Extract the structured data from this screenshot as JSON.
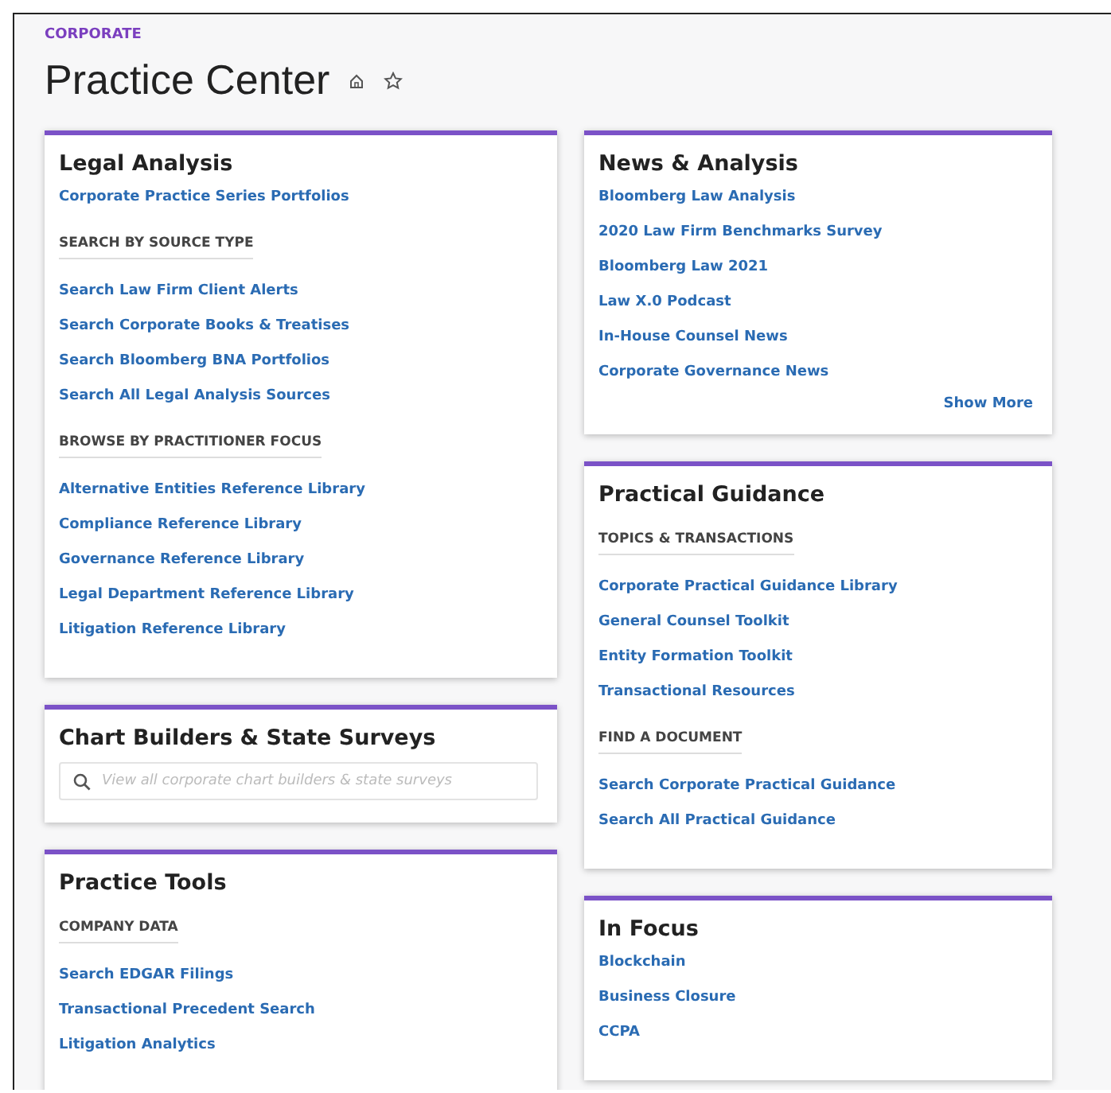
{
  "breadcrumb": "CORPORATE",
  "title": "Practice Center",
  "columns": [
    [
      {
        "title": "Legal Analysis",
        "items": [
          {
            "kind": "link",
            "text": "Corporate Practice Series Portfolios"
          },
          {
            "kind": "heading",
            "text": "SEARCH BY SOURCE TYPE"
          },
          {
            "kind": "link",
            "text": "Search Law Firm Client Alerts"
          },
          {
            "kind": "link",
            "text": "Search Corporate Books & Treatises"
          },
          {
            "kind": "link",
            "text": "Search Bloomberg BNA Portfolios"
          },
          {
            "kind": "link",
            "text": "Search All Legal Analysis Sources"
          },
          {
            "kind": "heading",
            "text": "BROWSE BY PRACTITIONER FOCUS"
          },
          {
            "kind": "link",
            "text": "Alternative Entities Reference Library"
          },
          {
            "kind": "link",
            "text": "Compliance Reference Library"
          },
          {
            "kind": "link",
            "text": "Governance Reference Library"
          },
          {
            "kind": "link",
            "text": "Legal Department Reference Library"
          },
          {
            "kind": "link",
            "text": "Litigation Reference Library"
          }
        ]
      },
      {
        "title": "Chart Builders & State Surveys",
        "items": [
          {
            "kind": "search",
            "placeholder": "View all corporate chart builders & state surveys"
          }
        ]
      },
      {
        "title": "Practice Tools",
        "items": [
          {
            "kind": "heading",
            "text": "COMPANY DATA"
          },
          {
            "kind": "link",
            "text": "Search EDGAR Filings"
          },
          {
            "kind": "link",
            "text": "Transactional Precedent Search"
          },
          {
            "kind": "link",
            "text": "Litigation Analytics"
          }
        ]
      }
    ],
    [
      {
        "title": "News & Analysis",
        "items": [
          {
            "kind": "link",
            "text": "Bloomberg Law Analysis"
          },
          {
            "kind": "link",
            "text": "2020 Law Firm Benchmarks Survey"
          },
          {
            "kind": "link",
            "text": "Bloomberg Law 2021"
          },
          {
            "kind": "link",
            "text": "Law X.0 Podcast"
          },
          {
            "kind": "link",
            "text": "In-House Counsel News"
          },
          {
            "kind": "link",
            "text": "Corporate Governance News"
          },
          {
            "kind": "more",
            "text": "Show More"
          }
        ]
      },
      {
        "title": "Practical Guidance",
        "items": [
          {
            "kind": "heading",
            "text": "TOPICS & TRANSACTIONS"
          },
          {
            "kind": "link",
            "text": "Corporate Practical Guidance Library"
          },
          {
            "kind": "link",
            "text": "General Counsel Toolkit"
          },
          {
            "kind": "link",
            "text": "Entity Formation Toolkit"
          },
          {
            "kind": "link",
            "text": "Transactional Resources"
          },
          {
            "kind": "heading",
            "text": "FIND A DOCUMENT"
          },
          {
            "kind": "link",
            "text": "Search Corporate Practical Guidance"
          },
          {
            "kind": "link",
            "text": "Search All Practical Guidance"
          }
        ]
      },
      {
        "title": "In Focus",
        "items": [
          {
            "kind": "link",
            "text": "Blockchain"
          },
          {
            "kind": "link",
            "text": "Business Closure"
          },
          {
            "kind": "link",
            "text": "CCPA"
          }
        ]
      }
    ]
  ]
}
